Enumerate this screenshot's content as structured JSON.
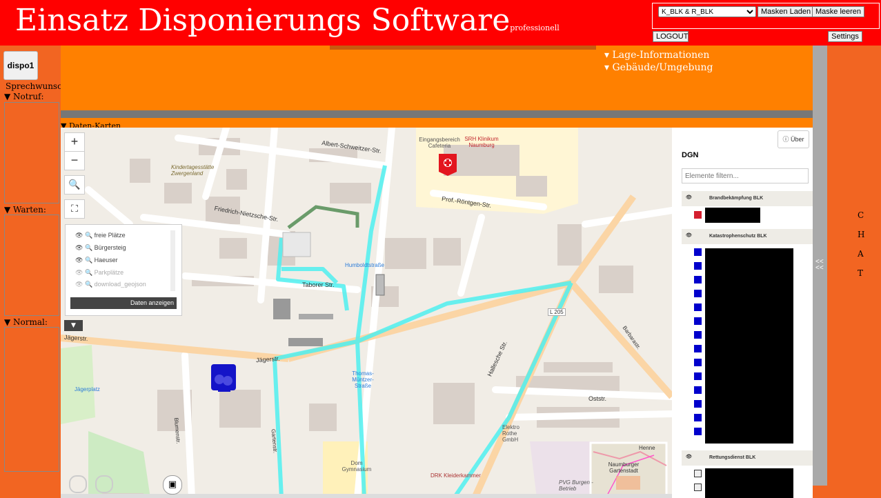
{
  "header": {
    "title": "Einsatz Disponierungs Software",
    "subtitle": "professionell",
    "mask_select_value": "K_BLK & R_BLK",
    "load_masks": "Masken Laden",
    "clear_masks": "Maske leeren",
    "logout": "LOGOUT",
    "settings": "Settings"
  },
  "left": {
    "dispo_button": "dispo1",
    "sprechwunsch": "Sprechwunsch",
    "notruf": "▼ Notruf:",
    "warten": "▼ Warten:",
    "normal": "▼ Normal:"
  },
  "top_panel": {
    "lage": "▾ Lage-Informationen",
    "gebaeude": "▾ Gebäude/Umgebung"
  },
  "daten_karten": "▼ Daten-Karten",
  "map": {
    "zoom_in": "+",
    "zoom_out": "−",
    "layers": [
      {
        "label": "freie Plätze",
        "active": true
      },
      {
        "label": "Bürgersteig",
        "active": true
      },
      {
        "label": "Haeuser",
        "active": true
      },
      {
        "label": "Parkplätze",
        "active": false
      },
      {
        "label": "download_geojson",
        "active": false
      }
    ],
    "show_data_button": "Daten anzeigen",
    "labels": {
      "albert_schweitzer": "Albert-Schweitzer-Str.",
      "friedrich_nietzsche": "Friedrich-Nietzsche-Str.",
      "taborer": "Taborer Str.",
      "jaegerstr": "Jägerstr.",
      "humboldtstrasse": "Humboldtstraße",
      "prof_roentgen": "Prof.-Röntgen-Str.",
      "thomas_muentzer": "Thomas-Müntzer-Straße",
      "srh": "SRH Klinikum Naumburg",
      "eingangsbereich": "Eingangsbereich Cafeteria",
      "kita": "Kindertagesstätte Zwergenland",
      "oststr": "Oststr.",
      "l205": "L 205",
      "elektro": "Elektro Rothe GmbH",
      "dom": "Dom Gymnasium",
      "drk": "DRK Kleiderkammer",
      "pvg": "PVG Burgen - Betrieb",
      "hallesche": "Hallesche Str.",
      "jaegerplatz": "Jägerplatz",
      "blumenstr": "Blumenstr.",
      "gartenstr": "Gartenstr.",
      "barbarastr": "Barbarastr.",
      "henne": "Henne",
      "mini_map": "Naumburger Gartenstadt"
    }
  },
  "right_panel": {
    "about": "Über",
    "title": "DGN",
    "filter_placeholder": "Elemente filtern...",
    "groups": [
      {
        "name": "Brandbekämpfung BLK",
        "rows": 1,
        "color": "#d41f2f"
      },
      {
        "name": "Katastrophenschutz BLK",
        "rows": 12,
        "color": "#0000cc"
      },
      {
        "name": "Rettungsdienst BLK",
        "rows": 2,
        "color": "#eeeeee"
      }
    ]
  },
  "collapse_toggle": "<<\n<<",
  "chat": [
    "C",
    "H",
    "A",
    "T"
  ],
  "colors": {
    "header": "#ff0000",
    "orange": "#ff8000",
    "dark_orange": "#f26522",
    "highlight": "#4ff0f0",
    "marker_red": "#e3161f",
    "marker_blue": "#1414c8"
  }
}
